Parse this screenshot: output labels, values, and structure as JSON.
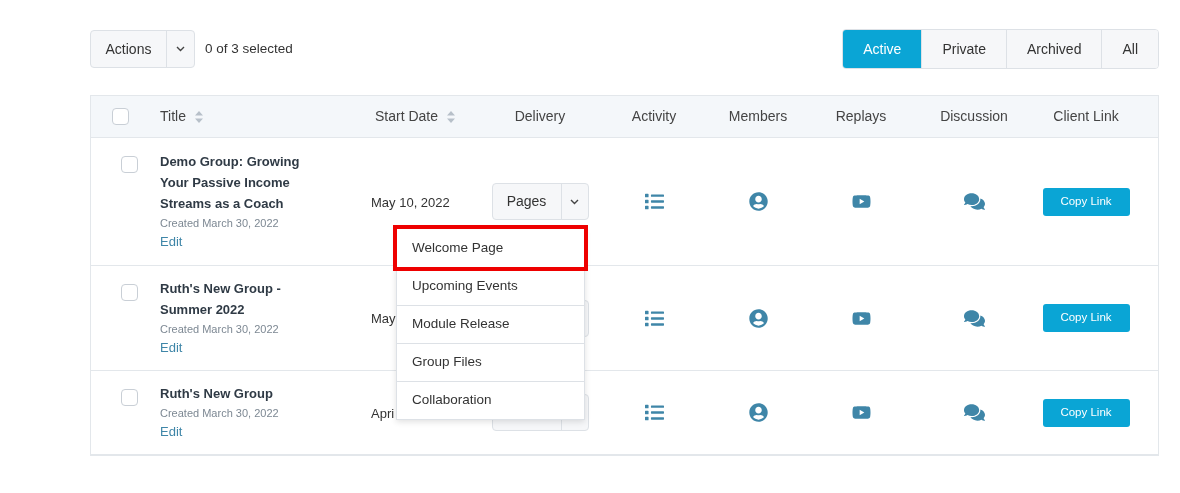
{
  "actions": {
    "label": "Actions",
    "selection": "0 of 3 selected"
  },
  "filters": [
    {
      "label": "Active",
      "selected": true
    },
    {
      "label": "Private",
      "selected": false
    },
    {
      "label": "Archived",
      "selected": false
    },
    {
      "label": "All",
      "selected": false
    }
  ],
  "table": {
    "select_all_checked": false,
    "columns": [
      {
        "label": "Title",
        "sortable": true
      },
      {
        "label": "Start Date",
        "sortable": true
      },
      {
        "label": "Delivery",
        "sortable": false
      },
      {
        "label": "Activity",
        "sortable": false
      },
      {
        "label": "Members",
        "sortable": false
      },
      {
        "label": "Replays",
        "sortable": false
      },
      {
        "label": "Discussion",
        "sortable": false
      },
      {
        "label": "Client Link",
        "sortable": false
      }
    ],
    "rows": [
      {
        "checked": false,
        "title": "Demo Group: Growing Your Passive Income Streams as a Coach",
        "created": "Created March 30, 2022",
        "edit": "Edit",
        "start_date": "May 10, 2022",
        "delivery": "Pages",
        "copy": "Copy Link"
      },
      {
        "checked": false,
        "title": "Ruth's New Group - Summer 2022",
        "created": "Created March 30, 2022",
        "edit": "Edit",
        "start_date": "May",
        "copy": "Copy Link"
      },
      {
        "checked": false,
        "title": "Ruth's New Group",
        "created": "Created March 30, 2022",
        "edit": "Edit",
        "start_date": "Apri",
        "copy": "Copy Link"
      }
    ]
  },
  "delivery_menu": [
    {
      "label": "Welcome Page",
      "selected": true
    },
    {
      "label": "Upcoming Events",
      "selected": false
    },
    {
      "label": "Module Release",
      "selected": false
    },
    {
      "label": "Group Files",
      "selected": false
    },
    {
      "label": "Collaboration",
      "selected": false
    }
  ]
}
